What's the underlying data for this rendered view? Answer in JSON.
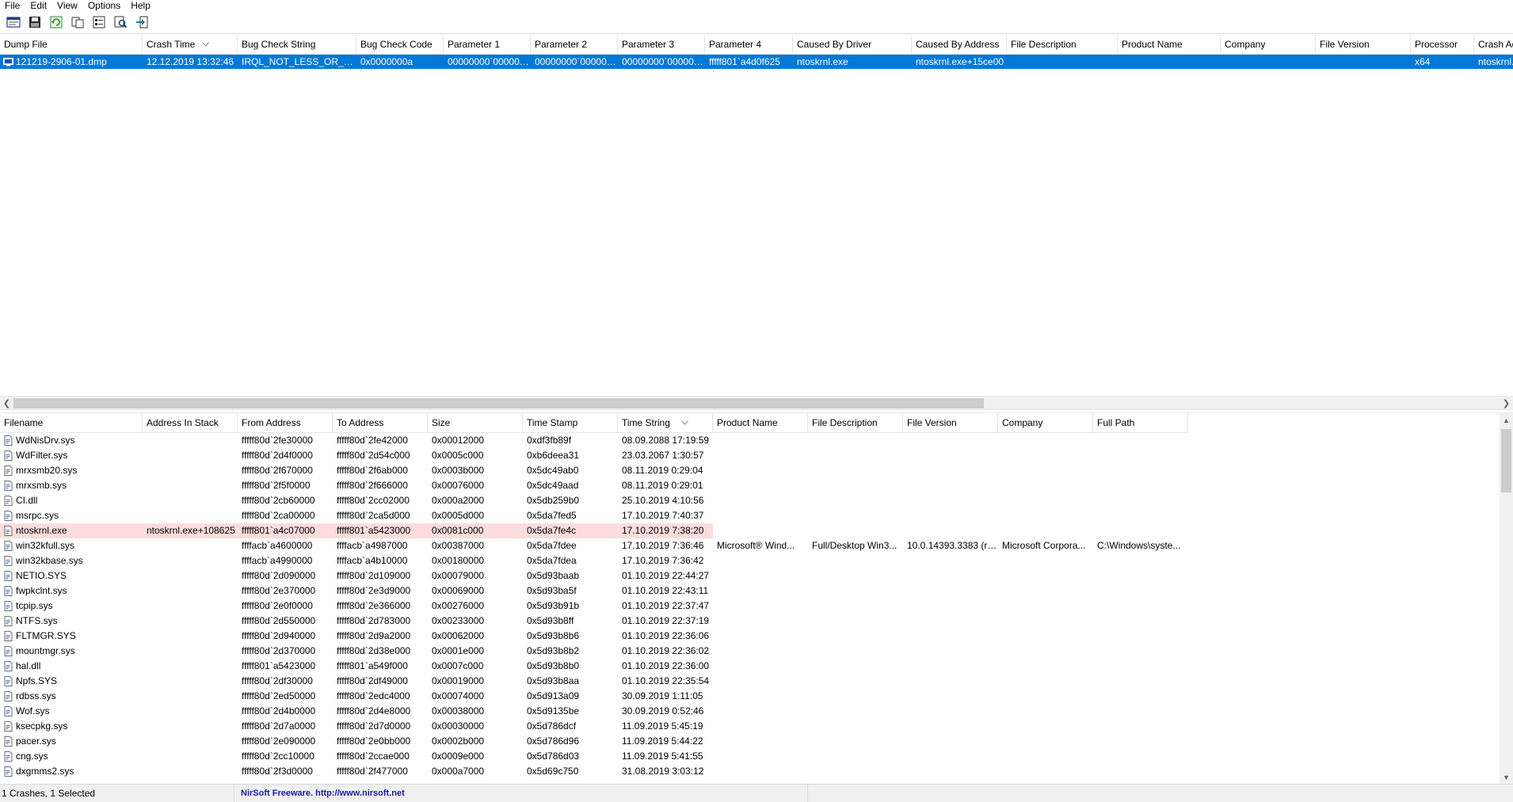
{
  "menu": [
    "File",
    "Edit",
    "View",
    "Options",
    "Help"
  ],
  "toolbar_icons": [
    "html-report-icon",
    "save-icon",
    "refresh-icon",
    "copy-icon",
    "properties-icon",
    "find-icon",
    "exit-icon"
  ],
  "crash_list": {
    "columns": [
      {
        "label": "Dump File",
        "width": 180
      },
      {
        "label": "Crash Time",
        "width": 120,
        "sort": true
      },
      {
        "label": "Bug Check String",
        "width": 150
      },
      {
        "label": "Bug Check Code",
        "width": 110
      },
      {
        "label": "Parameter 1",
        "width": 110
      },
      {
        "label": "Parameter 2",
        "width": 110
      },
      {
        "label": "Parameter 3",
        "width": 110
      },
      {
        "label": "Parameter 4",
        "width": 111
      },
      {
        "label": "Caused By Driver",
        "width": 150
      },
      {
        "label": "Caused By Address",
        "width": 120
      },
      {
        "label": "File Description",
        "width": 140
      },
      {
        "label": "Product Name",
        "width": 130
      },
      {
        "label": "Company",
        "width": 120
      },
      {
        "label": "File Version",
        "width": 120
      },
      {
        "label": "Processor",
        "width": 80
      },
      {
        "label": "Crash Ad",
        "width": 60
      }
    ],
    "rows": [
      [
        "121219-2906-01.dmp",
        "12.12.2019 13:32:46",
        "IRQL_NOT_LESS_OR_EQ...",
        "0x0000000a",
        "00000000`000000...",
        "00000000`000000...",
        "00000000`000000...",
        "fffff801`a4d0f625",
        "ntoskrnl.exe",
        "ntoskrnl.exe+15ce00",
        "",
        "",
        "",
        "",
        "x64",
        "ntoskrnl."
      ]
    ]
  },
  "module_list": {
    "columns": [
      {
        "label": "Filename",
        "width": 180
      },
      {
        "label": "Address In Stack",
        "width": 120
      },
      {
        "label": "From Address",
        "width": 120
      },
      {
        "label": "To Address",
        "width": 120
      },
      {
        "label": "Size",
        "width": 120
      },
      {
        "label": "Time Stamp",
        "width": 120
      },
      {
        "label": "Time String",
        "width": 120,
        "sort": true
      },
      {
        "label": "Product Name",
        "width": 120
      },
      {
        "label": "File Description",
        "width": 120
      },
      {
        "label": "File Version",
        "width": 120
      },
      {
        "label": "Company",
        "width": 120
      },
      {
        "label": "Full Path",
        "width": 120
      }
    ],
    "rows": [
      [
        "WdNisDrv.sys",
        "",
        "fffff80d`2fe30000",
        "fffff80d`2fe42000",
        "0x00012000",
        "0xdf3fb89f",
        "08.09.2088 17:19:59",
        "",
        "",
        "",
        "",
        ""
      ],
      [
        "WdFilter.sys",
        "",
        "fffff80d`2d4f0000",
        "fffff80d`2d54c000",
        "0x0005c000",
        "0xb6deea31",
        "23.03.2067 1:30:57",
        "",
        "",
        "",
        "",
        ""
      ],
      [
        "mrxsmb20.sys",
        "",
        "fffff80d`2f670000",
        "fffff80d`2f6ab000",
        "0x0003b000",
        "0x5dc49ab0",
        "08.11.2019 0:29:04",
        "",
        "",
        "",
        "",
        ""
      ],
      [
        "mrxsmb.sys",
        "",
        "fffff80d`2f5f0000",
        "fffff80d`2f666000",
        "0x00076000",
        "0x5dc49aad",
        "08.11.2019 0:29:01",
        "",
        "",
        "",
        "",
        ""
      ],
      [
        "CI.dll",
        "",
        "fffff80d`2cb60000",
        "fffff80d`2cc02000",
        "0x000a2000",
        "0x5db259b0",
        "25.10.2019 4:10:56",
        "",
        "",
        "",
        "",
        ""
      ],
      [
        "msrpc.sys",
        "",
        "fffff80d`2ca00000",
        "fffff80d`2ca5d000",
        "0x0005d000",
        "0x5da7fed5",
        "17.10.2019 7:40:37",
        "",
        "",
        "",
        "",
        ""
      ],
      [
        "ntoskrnl.exe",
        "ntoskrnl.exe+108625",
        "fffff801`a4c07000",
        "fffff801`a5423000",
        "0x0081c000",
        "0x5da7fe4c",
        "17.10.2019 7:38:20",
        "",
        "",
        "",
        "",
        ""
      ],
      [
        "win32kfull.sys",
        "",
        "ffffacb`a4600000",
        "ffffacb`a4987000",
        "0x00387000",
        "0x5da7fdee",
        "17.10.2019 7:36:46",
        "Microsoft® Wind...",
        "Full/Desktop Win3...",
        "10.0.14393.3383 (rs...",
        "Microsoft Corpora...",
        "C:\\Windows\\syste..."
      ],
      [
        "win32kbase.sys",
        "",
        "ffffacb`a4990000",
        "ffffacb`a4b10000",
        "0x00180000",
        "0x5da7fdea",
        "17.10.2019 7:36:42",
        "",
        "",
        "",
        "",
        ""
      ],
      [
        "NETIO.SYS",
        "",
        "fffff80d`2d090000",
        "fffff80d`2d109000",
        "0x00079000",
        "0x5d93baab",
        "01.10.2019 22:44:27",
        "",
        "",
        "",
        "",
        ""
      ],
      [
        "fwpkclnt.sys",
        "",
        "fffff80d`2e370000",
        "fffff80d`2e3d9000",
        "0x00069000",
        "0x5d93ba5f",
        "01.10.2019 22:43:11",
        "",
        "",
        "",
        "",
        ""
      ],
      [
        "tcpip.sys",
        "",
        "fffff80d`2e0f0000",
        "fffff80d`2e366000",
        "0x00276000",
        "0x5d93b91b",
        "01.10.2019 22:37:47",
        "",
        "",
        "",
        "",
        ""
      ],
      [
        "NTFS.sys",
        "",
        "fffff80d`2d550000",
        "fffff80d`2d783000",
        "0x00233000",
        "0x5d93b8ff",
        "01.10.2019 22:37:19",
        "",
        "",
        "",
        "",
        ""
      ],
      [
        "FLTMGR.SYS",
        "",
        "fffff80d`2d940000",
        "fffff80d`2d9a2000",
        "0x00062000",
        "0x5d93b8b6",
        "01.10.2019 22:36:06",
        "",
        "",
        "",
        "",
        ""
      ],
      [
        "mountmgr.sys",
        "",
        "fffff80d`2d370000",
        "fffff80d`2d38e000",
        "0x0001e000",
        "0x5d93b8b2",
        "01.10.2019 22:36:02",
        "",
        "",
        "",
        "",
        ""
      ],
      [
        "hal.dll",
        "",
        "fffff801`a5423000",
        "fffff801`a549f000",
        "0x0007c000",
        "0x5d93b8b0",
        "01.10.2019 22:36:00",
        "",
        "",
        "",
        "",
        ""
      ],
      [
        "Npfs.SYS",
        "",
        "fffff80d`2df30000",
        "fffff80d`2df49000",
        "0x00019000",
        "0x5d93b8aa",
        "01.10.2019 22:35:54",
        "",
        "",
        "",
        "",
        ""
      ],
      [
        "rdbss.sys",
        "",
        "fffff80d`2ed50000",
        "fffff80d`2edc4000",
        "0x00074000",
        "0x5d913a09",
        "30.09.2019 1:11:05",
        "",
        "",
        "",
        "",
        ""
      ],
      [
        "Wof.sys",
        "",
        "fffff80d`2d4b0000",
        "fffff80d`2d4e8000",
        "0x00038000",
        "0x5d9135be",
        "30.09.2019 0:52:46",
        "",
        "",
        "",
        "",
        ""
      ],
      [
        "ksecpkg.sys",
        "",
        "fffff80d`2d7a0000",
        "fffff80d`2d7d0000",
        "0x00030000",
        "0x5d786dcf",
        "11.09.2019 5:45:19",
        "",
        "",
        "",
        "",
        ""
      ],
      [
        "pacer.sys",
        "",
        "fffff80d`2e090000",
        "fffff80d`2e0bb000",
        "0x0002b000",
        "0x5d786d96",
        "11.09.2019 5:44:22",
        "",
        "",
        "",
        "",
        ""
      ],
      [
        "cng.sys",
        "",
        "fffff80d`2cc10000",
        "fffff80d`2ccae000",
        "0x0009e000",
        "0x5d786d03",
        "11.09.2019 5:41:55",
        "",
        "",
        "",
        "",
        ""
      ],
      [
        "dxgmms2.sys",
        "",
        "fffff80d`2f3d0000",
        "fffff80d`2f477000",
        "0x000a7000",
        "0x5d69c750",
        "31.08.2019 3:03:12",
        "",
        "",
        "",
        "",
        ""
      ]
    ]
  },
  "status": {
    "selection": "1 Crashes, 1 Selected",
    "credit": "NirSoft Freeware.  http://www.nirsoft.net"
  },
  "colors": {
    "selection": "#0078d7",
    "highlight_row": "#fcdcdc",
    "link": "#1a1aa6"
  }
}
